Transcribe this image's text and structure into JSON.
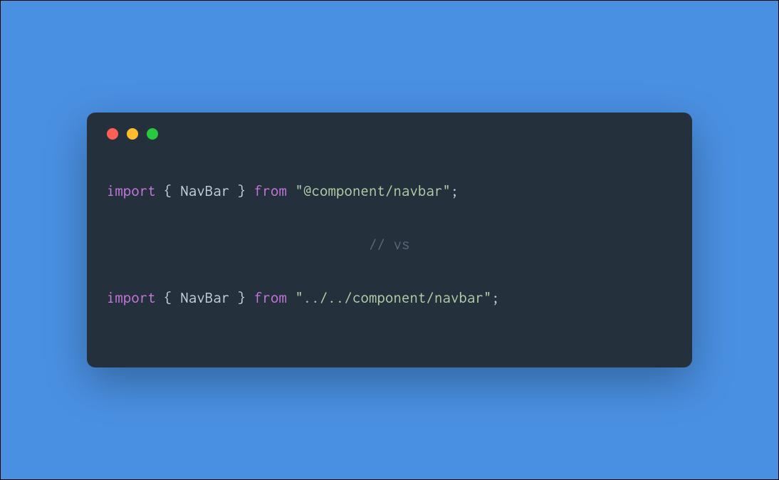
{
  "code": {
    "line1": {
      "import_kw": "import",
      "open_brace": " { ",
      "identifier": "NavBar",
      "close_brace": " } ",
      "from_kw": "from",
      "space": " ",
      "string": "\"@component/navbar\"",
      "semicolon": ";"
    },
    "comment": "// vs",
    "line2": {
      "import_kw": "import",
      "open_brace": " { ",
      "identifier": "NavBar",
      "close_brace": " } ",
      "from_kw": "from",
      "space": " ",
      "string": "\"../../component/navbar\"",
      "semicolon": ";"
    }
  }
}
